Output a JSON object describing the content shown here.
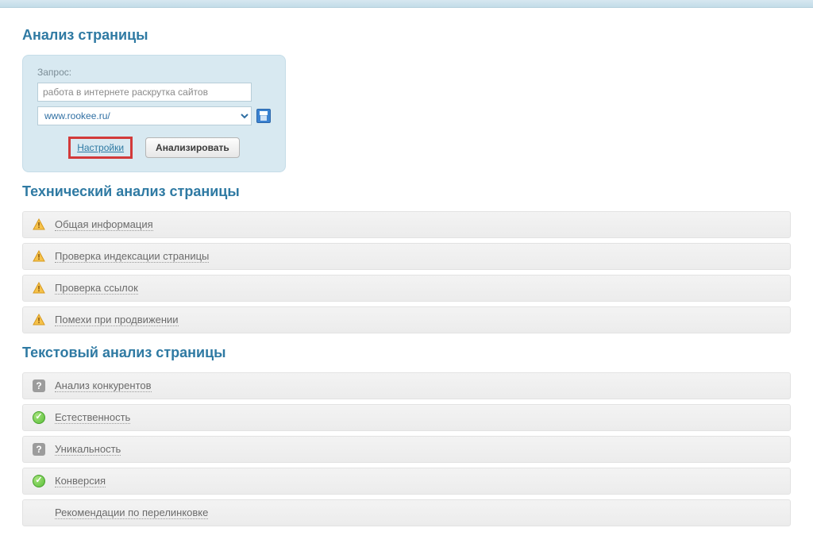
{
  "titles": {
    "page_analysis": "Анализ страницы",
    "technical": "Технический анализ страницы",
    "textual": "Текстовый анализ страницы"
  },
  "query": {
    "label": "Запрос:",
    "input_value": "работа в интернете раскрутка сайтов",
    "url_value": "www.rookee.ru/",
    "settings_link": "Настройки",
    "analyze_button": "Анализировать"
  },
  "technical_rows": [
    {
      "icon": "warn",
      "label": "Общая информация"
    },
    {
      "icon": "warn",
      "label": "Проверка индексации страницы"
    },
    {
      "icon": "warn",
      "label": "Проверка ссылок"
    },
    {
      "icon": "warn",
      "label": "Помехи при продвижении"
    }
  ],
  "textual_rows": [
    {
      "icon": "q",
      "label": "Анализ конкурентов"
    },
    {
      "icon": "ok",
      "label": "Естественность"
    },
    {
      "icon": "q",
      "label": "Уникальность"
    },
    {
      "icon": "ok",
      "label": "Конверсия"
    },
    {
      "icon": "none",
      "label": "Рекомендации по перелинковке"
    }
  ]
}
